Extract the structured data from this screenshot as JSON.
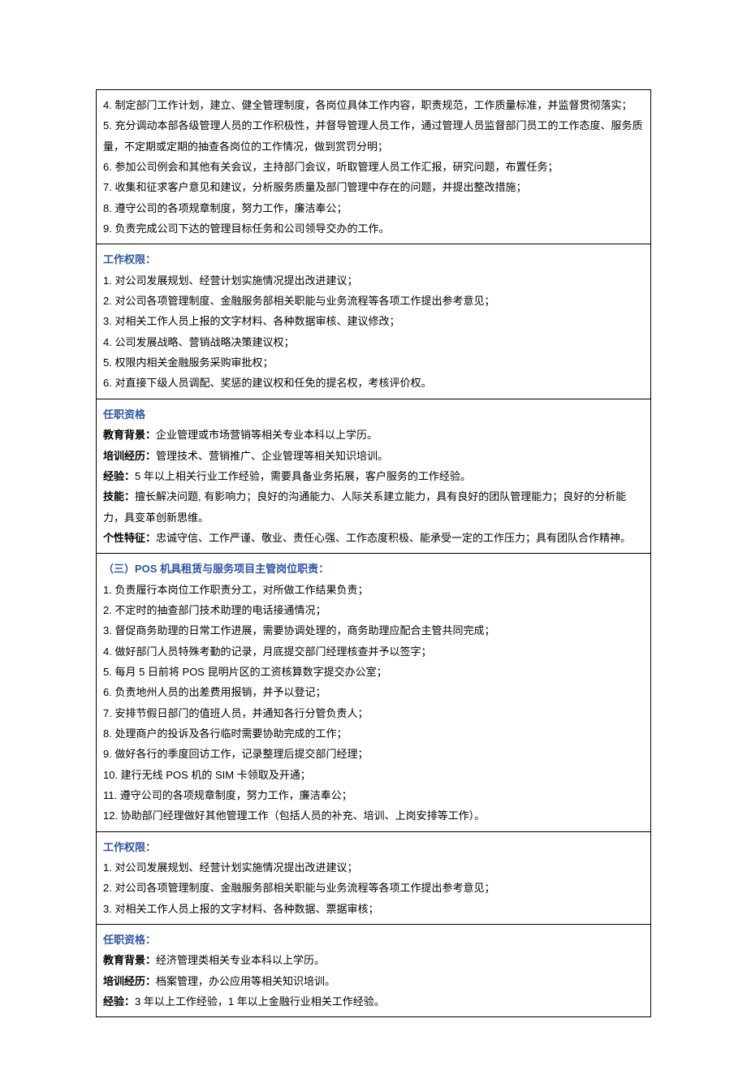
{
  "row1": {
    "items": [
      "4. 制定部门工作计划，建立、健全管理制度，各岗位具体工作内容，职责规范，工作质量标准，并监督贯彻落实；",
      "5. 充分调动本部各级管理人员的工作积极性，并督导管理人员工作，通过管理人员监督部门员工的工作态度、服务质量，不定期或定期的抽查各岗位的工作情况，做到赏罚分明；",
      "6. 参加公司例会和其他有关会议，主持部门会议，听取管理人员工作汇报，研究问题，布置任务；",
      "7. 收集和征求客户意见和建议，分析服务质量及部门管理中存在的问题，并提出整改措施；",
      "8. 遵守公司的各项规章制度，努力工作，廉洁奉公；",
      "9. 负责完成公司下达的管理目标任务和公司领导交办的工作。"
    ]
  },
  "row2": {
    "heading": "工作权限：",
    "items": [
      "1. 对公司发展规划、经营计划实施情况提出改进建议；",
      "2. 对公司各项管理制度、金融服务部相关职能与业务流程等各项工作提出参考意见；",
      "3. 对相关工作人员上报的文字材料、各种数据审核、建议修改；",
      "4. 公司发展战略、营销战略决策建议权；",
      "5. 权限内相关金融服务采购审批权；",
      "6. 对直接下级人员调配、奖惩的建议权和任免的提名权，考核评价权。"
    ]
  },
  "row3": {
    "heading": "任职资格",
    "edu_label": "教育背景：",
    "edu_text": "企业管理或市场营销等相关专业本科以上学历。",
    "train_label": "培训经历：",
    "train_text": "管理技术、营销推广、企业管理等相关知识培训。",
    "exp_label": "经验：",
    "exp_text": "5 年以上相关行业工作经验，需要具备业务拓展，客户服务的工作经验。",
    "skill_label": "技能：",
    "skill_text": "擅长解决问题, 有影响力；良好的沟通能力、人际关系建立能力，具有良好的团队管理能力；良好的分析能力，具变革创新思维。",
    "pers_label": "个性特征：",
    "pers_text": "忠诚守信、工作严谨、敬业、责任心强、工作态度积极、能承受一定的工作压力；具有团队合作精神。"
  },
  "row4": {
    "heading": "（三）POS 机具租赁与服务项目主管岗位职责：",
    "items": [
      "1. 负责履行本岗位工作职责分工，对所做工作结果负责；",
      "2. 不定时的抽查部门技术助理的电话接通情况；",
      "3. 督促商务助理的日常工作进展，需要协调处理的，商务助理应配合主管共同完成；",
      "4. 做好部门人员特殊考勤的记录，月底提交部门经理核查并予以签字；",
      "5. 每月 5 日前将 POS 昆明片区的工资核算数字提交办公室；",
      "6. 负责地州人员的出差费用报销，并予以登记；",
      "7. 安排节假日部门的值班人员，并通知各行分管负责人；",
      "8. 处理商户的投诉及各行临时需要协助完成的工作；",
      "9. 做好各行的季度回访工作，记录整理后提交部门经理；",
      "10. 建行无线 POS 机的 SIM 卡领取及开通；",
      "11. 遵守公司的各项规章制度，努力工作，廉洁奉公；",
      "12. 协助部门经理做好其他管理工作（包括人员的补充、培训、上岗安排等工作）。"
    ]
  },
  "row5": {
    "heading": "工作权限：",
    "items": [
      "1. 对公司发展规划、经营计划实施情况提出改进建议；",
      "2. 对公司各项管理制度、金融服务部相关职能与业务流程等各项工作提出参考意见；",
      "3. 对相关工作人员上报的文字材料、各种数据、票据审核；"
    ]
  },
  "row6": {
    "heading": "任职资格：",
    "edu_label": "教育背景：",
    "edu_text": "经济管理类相关专业本科以上学历。",
    "train_label": "培训经历：",
    "train_text": "档案管理，办公应用等相关知识培训。",
    "exp_label": "经验：",
    "exp_text": "3 年以上工作经验，1 年以上金融行业相关工作经验。"
  }
}
